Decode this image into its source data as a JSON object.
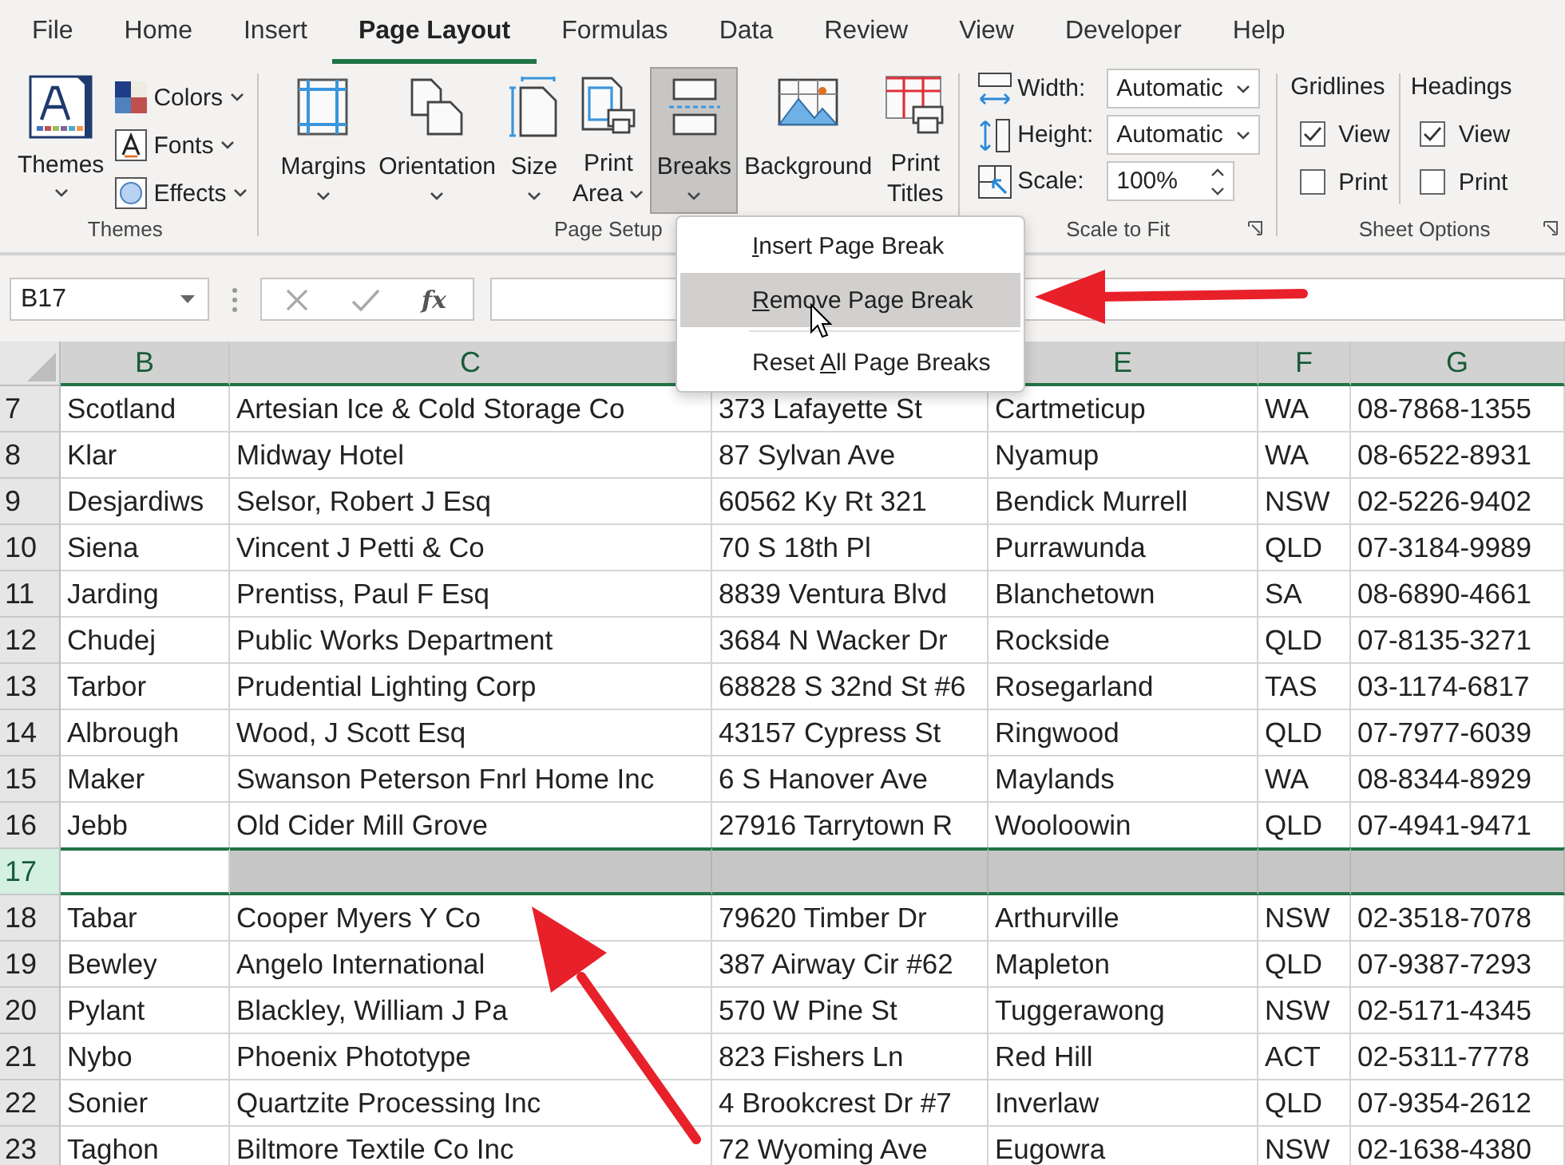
{
  "menu_tabs": [
    {
      "label": "File",
      "selected": false
    },
    {
      "label": "Home",
      "selected": false
    },
    {
      "label": "Insert",
      "selected": false
    },
    {
      "label": "Page Layout",
      "selected": true
    },
    {
      "label": "Formulas",
      "selected": false
    },
    {
      "label": "Data",
      "selected": false
    },
    {
      "label": "Review",
      "selected": false
    },
    {
      "label": "View",
      "selected": false
    },
    {
      "label": "Developer",
      "selected": false
    },
    {
      "label": "Help",
      "selected": false
    }
  ],
  "themes_group": {
    "label": "Themes",
    "big": {
      "label": "Themes"
    },
    "small": [
      {
        "kind": "colors",
        "label": "Colors"
      },
      {
        "kind": "fonts",
        "label": "Fonts"
      },
      {
        "kind": "effects",
        "label": "Effects"
      }
    ]
  },
  "page_setup_group": {
    "label": "Page Setup",
    "buttons": [
      {
        "kind": "margins",
        "lines": [
          "Margins"
        ],
        "has_caret": true,
        "pressed": false
      },
      {
        "kind": "orientation",
        "lines": [
          "Orientation"
        ],
        "has_caret": true,
        "pressed": false
      },
      {
        "kind": "size",
        "lines": [
          "Size"
        ],
        "has_caret": true,
        "pressed": false
      },
      {
        "kind": "print_area",
        "lines": [
          "Print",
          "Area"
        ],
        "has_caret": true,
        "pressed": false
      },
      {
        "kind": "breaks",
        "lines": [
          "Breaks"
        ],
        "has_caret": true,
        "pressed": true
      },
      {
        "kind": "background",
        "lines": [
          "Background"
        ],
        "pressed": false
      },
      {
        "kind": "print_titles",
        "lines": [
          "Print",
          "Titles"
        ],
        "pressed": false
      }
    ]
  },
  "scale_group": {
    "label": "Scale to Fit",
    "launcher": true,
    "rows": [
      {
        "kind": "width",
        "label": "Width:",
        "value": "Automatic",
        "dropdown": true
      },
      {
        "kind": "height",
        "label": "Height:",
        "value": "Automatic",
        "dropdown": true
      },
      {
        "kind": "scale",
        "label": "Scale:",
        "value": "100%",
        "spinner": true
      }
    ]
  },
  "sheet_options_group": {
    "label": "Sheet Options",
    "launcher": true,
    "sections": [
      {
        "label": "Gridlines",
        "view": {
          "label": "View",
          "checked": true
        },
        "print": {
          "label": "Print",
          "checked": false
        }
      },
      {
        "label": "Headings",
        "view": {
          "label": "View",
          "checked": true
        },
        "print": {
          "label": "Print",
          "checked": false
        }
      }
    ]
  },
  "formula_bar": {
    "name_box": "B17",
    "function_label": "fx"
  },
  "columns": [
    {
      "letter": "B",
      "selected": true
    },
    {
      "letter": "C",
      "selected": true
    },
    {},
    {
      "letter": "E",
      "selected": true
    },
    {
      "letter": "F",
      "selected": true
    },
    {
      "letter": "G",
      "selected": true
    }
  ],
  "rows": [
    {
      "number": "7",
      "selected": false,
      "cells": [
        "Scotland",
        "Artesian Ice & Cold Storage Co",
        "373 Lafayette St",
        "Cartmeticup",
        "WA",
        "08-7868-1355"
      ]
    },
    {
      "number": "8",
      "selected": false,
      "cells": [
        "Klar",
        "Midway Hotel",
        "87 Sylvan Ave",
        "Nyamup",
        "WA",
        "08-6522-8931"
      ]
    },
    {
      "number": "9",
      "selected": false,
      "cells": [
        "Desjardiws",
        "Selsor, Robert J Esq",
        "60562 Ky Rt 321",
        "Bendick Murrell",
        "NSW",
        "02-5226-9402"
      ]
    },
    {
      "number": "10",
      "selected": false,
      "cells": [
        "Siena",
        "Vincent J Petti & Co",
        "70 S 18th Pl",
        "Purrawunda",
        "QLD",
        "07-3184-9989"
      ]
    },
    {
      "number": "11",
      "selected": false,
      "cells": [
        "Jarding",
        "Prentiss, Paul F Esq",
        "8839 Ventura Blvd",
        "Blanchetown",
        "SA",
        "08-6890-4661"
      ]
    },
    {
      "number": "12",
      "selected": false,
      "cells": [
        "Chudej",
        "Public Works Department",
        "3684 N Wacker Dr",
        "Rockside",
        "QLD",
        "07-8135-3271"
      ]
    },
    {
      "number": "13",
      "selected": false,
      "cells": [
        "Tarbor",
        "Prudential Lighting Corp",
        "68828 S 32nd St #6",
        "Rosegarland",
        "TAS",
        "03-1174-6817"
      ]
    },
    {
      "number": "14",
      "selected": false,
      "cells": [
        "Albrough",
        "Wood, J Scott Esq",
        "43157 Cypress St",
        "Ringwood",
        "QLD",
        "07-7977-6039"
      ]
    },
    {
      "number": "15",
      "selected": false,
      "cells": [
        "Maker",
        "Swanson Peterson Fnrl Home Inc",
        "6 S Hanover Ave",
        "Maylands",
        "WA",
        "08-8344-8929"
      ]
    },
    {
      "number": "16",
      "selected": false,
      "cells": [
        "Jebb",
        "Old Cider Mill Grove",
        "27916 Tarrytown R",
        "Wooloowin",
        "QLD",
        "07-4941-9471"
      ]
    },
    {
      "number": "17",
      "selected": true
    },
    {
      "number": "18",
      "selected": false,
      "cells": [
        "Tabar",
        "Cooper Myers Y Co",
        "79620 Timber Dr",
        "Arthurville",
        "NSW",
        "02-3518-7078"
      ]
    },
    {
      "number": "19",
      "selected": false,
      "cells": [
        "Bewley",
        "Angelo International",
        "387 Airway Cir #62",
        "Mapleton",
        "QLD",
        "07-9387-7293"
      ]
    },
    {
      "number": "20",
      "selected": false,
      "cells": [
        "Pylant",
        "Blackley, William J Pa",
        "570 W Pine St",
        "Tuggerawong",
        "NSW",
        "02-5171-4345"
      ]
    },
    {
      "number": "21",
      "selected": false,
      "cells": [
        "Nybo",
        "Phoenix Phototype",
        "823 Fishers Ln",
        "Red Hill",
        "ACT",
        "02-5311-7778"
      ]
    },
    {
      "number": "22",
      "selected": false,
      "cells": [
        "Sonier",
        "Quartzite Processing Inc",
        "4 Brookcrest Dr #7",
        "Inverlaw",
        "QLD",
        "07-9354-2612"
      ]
    },
    {
      "number": "23",
      "selected": false,
      "cells": [
        "Taghon",
        "Biltmore Textile Co Inc",
        "72 Wyoming Ave",
        "Eugowra",
        "NSW",
        "02-1638-4380"
      ]
    }
  ],
  "breaks_menu": [
    {
      "key": "I",
      "after": "nsert Page Break",
      "selected": false
    },
    {
      "key": "R",
      "after": "emove Page Break",
      "selected": true
    },
    {
      "before": "Reset ",
      "key": "A",
      "after": "ll Page Breaks",
      "selected": false
    }
  ]
}
